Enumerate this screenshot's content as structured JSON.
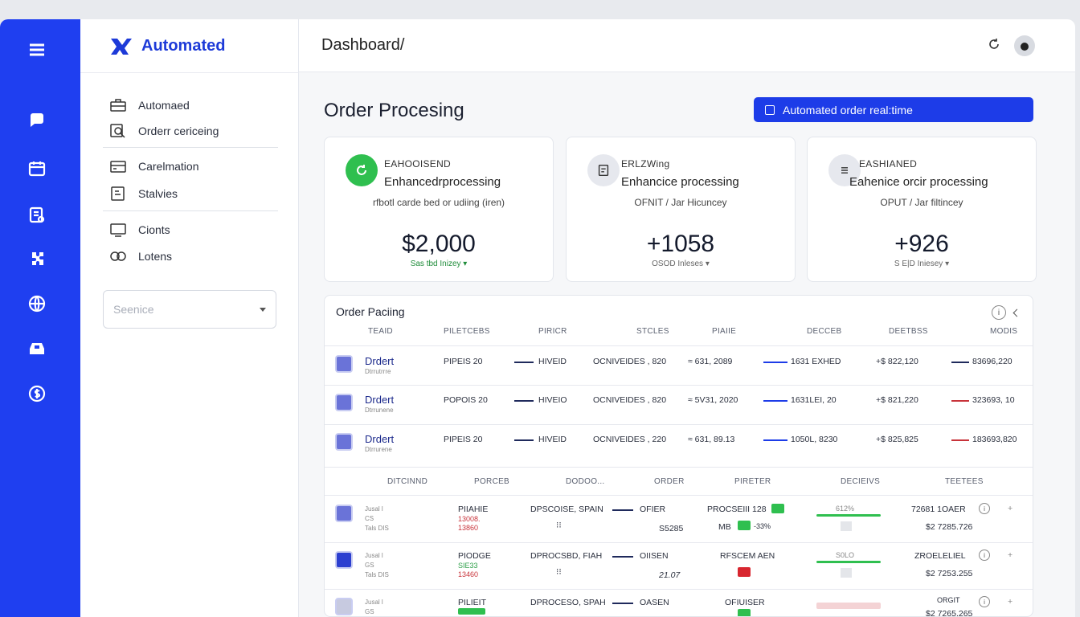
{
  "brand": {
    "name": "Automated"
  },
  "sidebar": {
    "items": [
      {
        "label": "Automaed",
        "icon": "briefcase-icon"
      },
      {
        "label": "Orderr cericeing",
        "icon": "search-doc-icon"
      },
      {
        "label": "Carelmation",
        "icon": "card-icon"
      },
      {
        "label": "Stalvies",
        "icon": "doc-icon"
      },
      {
        "label": "Cionts",
        "icon": "monitor-icon"
      },
      {
        "label": "Lotens",
        "icon": "link-icon"
      }
    ],
    "select_placeholder": "Seenice"
  },
  "topbar": {
    "breadcrumb": "Dashboard/"
  },
  "page": {
    "title": "Order Procesing",
    "cta_label": "Automated order real:time"
  },
  "cards": [
    {
      "kicker": "EAHOOISEND",
      "heading": "Enhancedrprocessing",
      "sub": "rfbotl carde bed or udiing (iren)",
      "value": "$2,000",
      "delta": "Sas tbd Inizey ▾"
    },
    {
      "kicker": "ERLZWing",
      "heading": "Enhancice processing",
      "sub": "OFNIT / Jar Hicuncey",
      "value": "+1058",
      "delta": "OSOD Inleses ▾"
    },
    {
      "kicker": "ЕАSHIANED",
      "heading": "Eahenice orcir processing",
      "sub": "OPUT / Jar filtincey",
      "value": "+926",
      "delta": "S E|D Iniesey ▾"
    }
  ],
  "table1": {
    "title": "Order Paciing",
    "columns": [
      "TEAID",
      "PILETCEBS",
      "PIRICR",
      "STCLES",
      "PIAIIE",
      "DECCEB",
      "DEETBSS",
      "MODIS"
    ],
    "rows": [
      {
        "name": "Drdert",
        "sub": "Dtrrutrrre",
        "c1": "PIPEIS 20",
        "c2": "HIVEID",
        "c3": "OCNIVEIDES , 820",
        "c4": "≈ 631, 2089",
        "c5": "1631 EXHED",
        "c6": "+$ 822,120",
        "c7": "83696,220"
      },
      {
        "name": "Drdert",
        "sub": "Dtrrunene",
        "c1": "POPOIS 20",
        "c2": "HIVEIO",
        "c3": "OCNIVEIDES , 820",
        "c4": "≈ 5V31, 2020",
        "c5": "1631LEI, 20",
        "c6": "+$ 821,220",
        "c7": "323693, 10"
      },
      {
        "name": "Drdert",
        "sub": "Dtrrurene",
        "c1": "PIPEIS 20",
        "c2": "HIVEID",
        "c3": "OCNIVEIDES , 220",
        "c4": "≈ 631, 89.13",
        "c5": "1050L, 8230",
        "c6": "+$ 825,825",
        "c7": "183693,820"
      }
    ]
  },
  "table2": {
    "columns": [
      "DITCINND",
      "PORCEB",
      "DODOO...",
      "ORDER",
      "PIRETER",
      "DECIEIVS",
      "TEETEES"
    ],
    "rows": [
      {
        "t1": "Jusal l",
        "t2": "CS",
        "t3": "Tals DIS",
        "b1": "PIIAHIE",
        "b2": "13008.",
        "b3": "13860",
        "c": "DPSCOISE, SPAIN",
        "g": "⁝⁝",
        "d": "OFIER",
        "e": "S5285",
        "f": "PROCSEIII 128",
        "f2": "MB",
        "f3": "-33%",
        "p": "612%",
        "m": "72681 1OAER",
        "m2": "$2 7285.726"
      },
      {
        "t1": "Jusal l",
        "t2": "GS",
        "t3": "Tals DIS",
        "b1": "PIODGE",
        "b2": "SIE33",
        "b3": "13460",
        "c": "DPROCSBD, FIAH",
        "g": "⁝⁝",
        "d": "OIISEN",
        "e": "21.07",
        "f": "RFSCEM AEN",
        "f2": "",
        "f3": "",
        "p": "S0LO",
        "m": "ZROELELIEL",
        "m2": "$2 7253.255"
      },
      {
        "t1": "Jusal l",
        "t2": "GS",
        "t3": "",
        "b1": "PILIEIT",
        "b2": "",
        "b3": "",
        "c": "DPROCESO, SPAH",
        "g": "",
        "d": "OASEN",
        "e": "",
        "f": "OFIUISER",
        "f2": "",
        "f3": "",
        "p": "",
        "m": "ORGIT",
        "m2": "$2 7265.265"
      }
    ]
  },
  "colors": {
    "accent": "#1f3ff0",
    "positive": "#1f8c3a",
    "negative": "#c8333a"
  }
}
